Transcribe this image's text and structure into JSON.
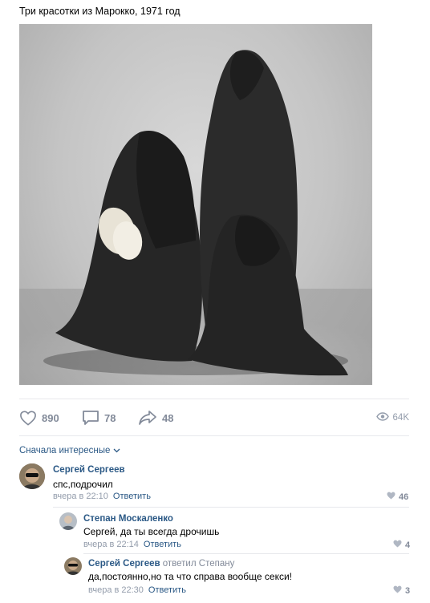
{
  "post": {
    "title": "Три красотки из Марокко, 1971 год"
  },
  "actions": {
    "likes": "890",
    "comments": "78",
    "shares": "48",
    "views": "64K"
  },
  "sort": {
    "label": "Сначала интересные"
  },
  "comments": [
    {
      "author": "Сергей Сергеев",
      "reply_to": "",
      "text": "спс,подрочил",
      "time": "вчера в 22:10",
      "reply_label": "Ответить",
      "likes": "46"
    },
    {
      "author": "Степан Москаленко",
      "reply_to": "",
      "text": "Сергей, да ты всегда дрочишь",
      "time": "вчера в 22:14",
      "reply_label": "Ответить",
      "likes": "4"
    },
    {
      "author": "Сергей Сергеев",
      "reply_to": "ответил Степану",
      "text": "да,постоянно,но та что справа вообще секси!",
      "time": "вчера в 22:30",
      "reply_label": "Ответить",
      "likes": "3"
    }
  ],
  "colors": {
    "link": "#2a5885",
    "muted": "#828a99",
    "separator": "#e7e8ec"
  }
}
